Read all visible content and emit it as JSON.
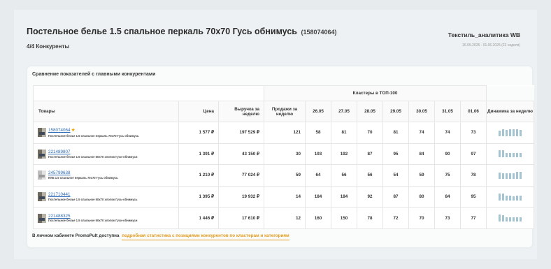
{
  "header": {
    "title": "Постельное белье 1.5 спальное перкаль 70x70 Гусь обнимусь",
    "product_id": "(158074064)",
    "competitors": "4/4 Конкуренты",
    "brand": "Текстиль_аналитика WB",
    "period": "26.05.2025 - 01.06.2025 (22 неделя)"
  },
  "card": {
    "title": "Сравнение показателей с главными конкурентами"
  },
  "table": {
    "group_header": "Кластеры в ТОП-100",
    "columns": {
      "products": "Товары",
      "price": "Цена",
      "revenue": "Выручка за неделю",
      "sales": "Продажи за неделю",
      "days": [
        "26.05",
        "27.05",
        "28.05",
        "29.05",
        "30.05",
        "31.05",
        "01.06"
      ],
      "dynamics": "Динамика за неделю"
    },
    "rows": [
      {
        "id": "158074064",
        "name": "Постельное белье 1.5 спальное перкаль 70x70 Гусь обнимусь",
        "own": true,
        "thumb": "dark",
        "price": "1 577 ₽",
        "revenue": "197 529 ₽",
        "sales": "121",
        "clusters": [
          "58",
          "81",
          "70",
          "81",
          "74",
          "74",
          "73"
        ],
        "spark": [
          58,
          81,
          70,
          81,
          74,
          74,
          73
        ]
      },
      {
        "id": "221489807",
        "name": "Постельное белье 1.5 спальное 50x70 хлопок Гуси-обнимуси",
        "own": false,
        "thumb": "dark",
        "price": "1 391 ₽",
        "revenue": "43 150 ₽",
        "sales": "30",
        "clusters": [
          "193",
          "192",
          "87",
          "95",
          "84",
          "90",
          "97"
        ],
        "spark": [
          193,
          192,
          87,
          95,
          84,
          90,
          97
        ]
      },
      {
        "id": "245799638",
        "name": "КПБ 1.5 спальное перкаль 70x70 Гусь обнимусь",
        "own": false,
        "thumb": "light",
        "price": "1 210 ₽",
        "revenue": "77 024 ₽",
        "sales": "59",
        "clusters": [
          "64",
          "56",
          "56",
          "54",
          "59",
          "75",
          "78"
        ],
        "spark": [
          64,
          56,
          56,
          54,
          59,
          75,
          78
        ]
      },
      {
        "id": "221710441",
        "name": "Постельное белье 1.5 спальное 50x70 хлопок Гусь-обнимусь",
        "own": false,
        "thumb": "dark",
        "price": "1 395 ₽",
        "revenue": "19 932 ₽",
        "sales": "14",
        "clusters": [
          "184",
          "184",
          "92",
          "87",
          "80",
          "84",
          "95"
        ],
        "spark": [
          184,
          184,
          92,
          87,
          80,
          84,
          95
        ]
      },
      {
        "id": "221488325",
        "name": "Постельное белье 1.5 спальное 50x70 хлопок Гуси-обнимуси",
        "own": false,
        "thumb": "dark",
        "price": "1 446 ₽",
        "revenue": "17 610 ₽",
        "sales": "12",
        "clusters": [
          "160",
          "150",
          "78",
          "72",
          "70",
          "73",
          "77"
        ],
        "spark": [
          160,
          150,
          78,
          72,
          70,
          73,
          77
        ]
      }
    ]
  },
  "footer": {
    "text": "В личном кабинете PromoPult доступна",
    "link": "подробная статистика с позициями конкурентов по кластерам и категориям"
  },
  "colors": {
    "link": "#2f6bb3",
    "accent_orange": "#e39a1d",
    "spark_bar": "#a3c4d0",
    "star": "#f0a500"
  }
}
